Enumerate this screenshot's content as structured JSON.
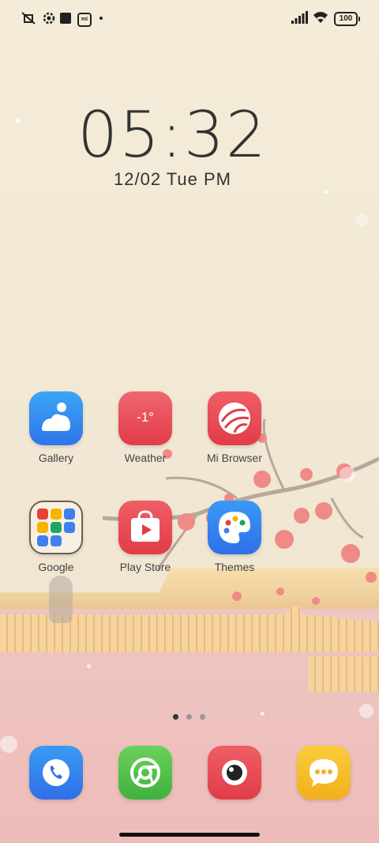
{
  "status_bar": {
    "icons": [
      "vibrate-off-icon",
      "settings-gear-icon",
      "square-notification-icon",
      "mi-icon",
      "dot-icon",
      "signal-icon",
      "wifi-icon"
    ],
    "battery": "100"
  },
  "lock_widget": {
    "time": "05:32",
    "date": "12/02  Tue  PM"
  },
  "apps": [
    {
      "label": "Gallery",
      "icon": "gallery-icon"
    },
    {
      "label": "Weather",
      "icon": "weather-icon",
      "icon_text": "-1°"
    },
    {
      "label": "Mi Browser",
      "icon": "browser-icon"
    },
    {
      "label": "Google",
      "icon": "google-folder-icon"
    },
    {
      "label": "Play Store",
      "icon": "play-store-icon"
    },
    {
      "label": "Themes",
      "icon": "themes-icon"
    }
  ],
  "page_indicator": {
    "count": 3,
    "active": 1
  },
  "dock": [
    "phone-icon",
    "chrome-icon",
    "camera-icon",
    "messages-icon"
  ],
  "colors": {
    "blue": "#3f7ff0",
    "red": "#e54b55",
    "green": "#55c24a",
    "yellow": "#f6bd2a"
  }
}
